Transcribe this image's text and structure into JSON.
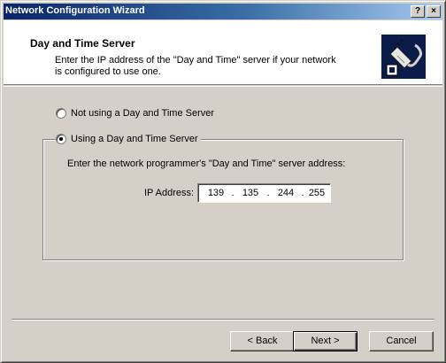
{
  "window": {
    "title": "Network Configuration Wizard",
    "help_button": "?",
    "close_button": "×"
  },
  "header": {
    "title": "Day and Time Server",
    "description": "Enter the IP address of the \"Day and Time\" server if your network is configured to use one.",
    "icon": "network-cable-chip-icon"
  },
  "options": {
    "not_using_label": "Not using a Day and Time Server",
    "using_label": "Using a Day and Time Server",
    "selected": "using"
  },
  "server": {
    "instruction": "Enter the network programmer's \"Day and Time\" server address:",
    "ip_label": "IP Address:",
    "ip_octets": [
      "139",
      "135",
      "244",
      "255"
    ],
    "separator": "."
  },
  "buttons": {
    "back": "< Back",
    "next": "Next >",
    "cancel": "Cancel"
  },
  "colors": {
    "title_gradient_start": "#0a246a",
    "title_gradient_end": "#a6caf0",
    "dialog_face": "#d4d0c8",
    "icon_background": "#0c1c4a"
  }
}
